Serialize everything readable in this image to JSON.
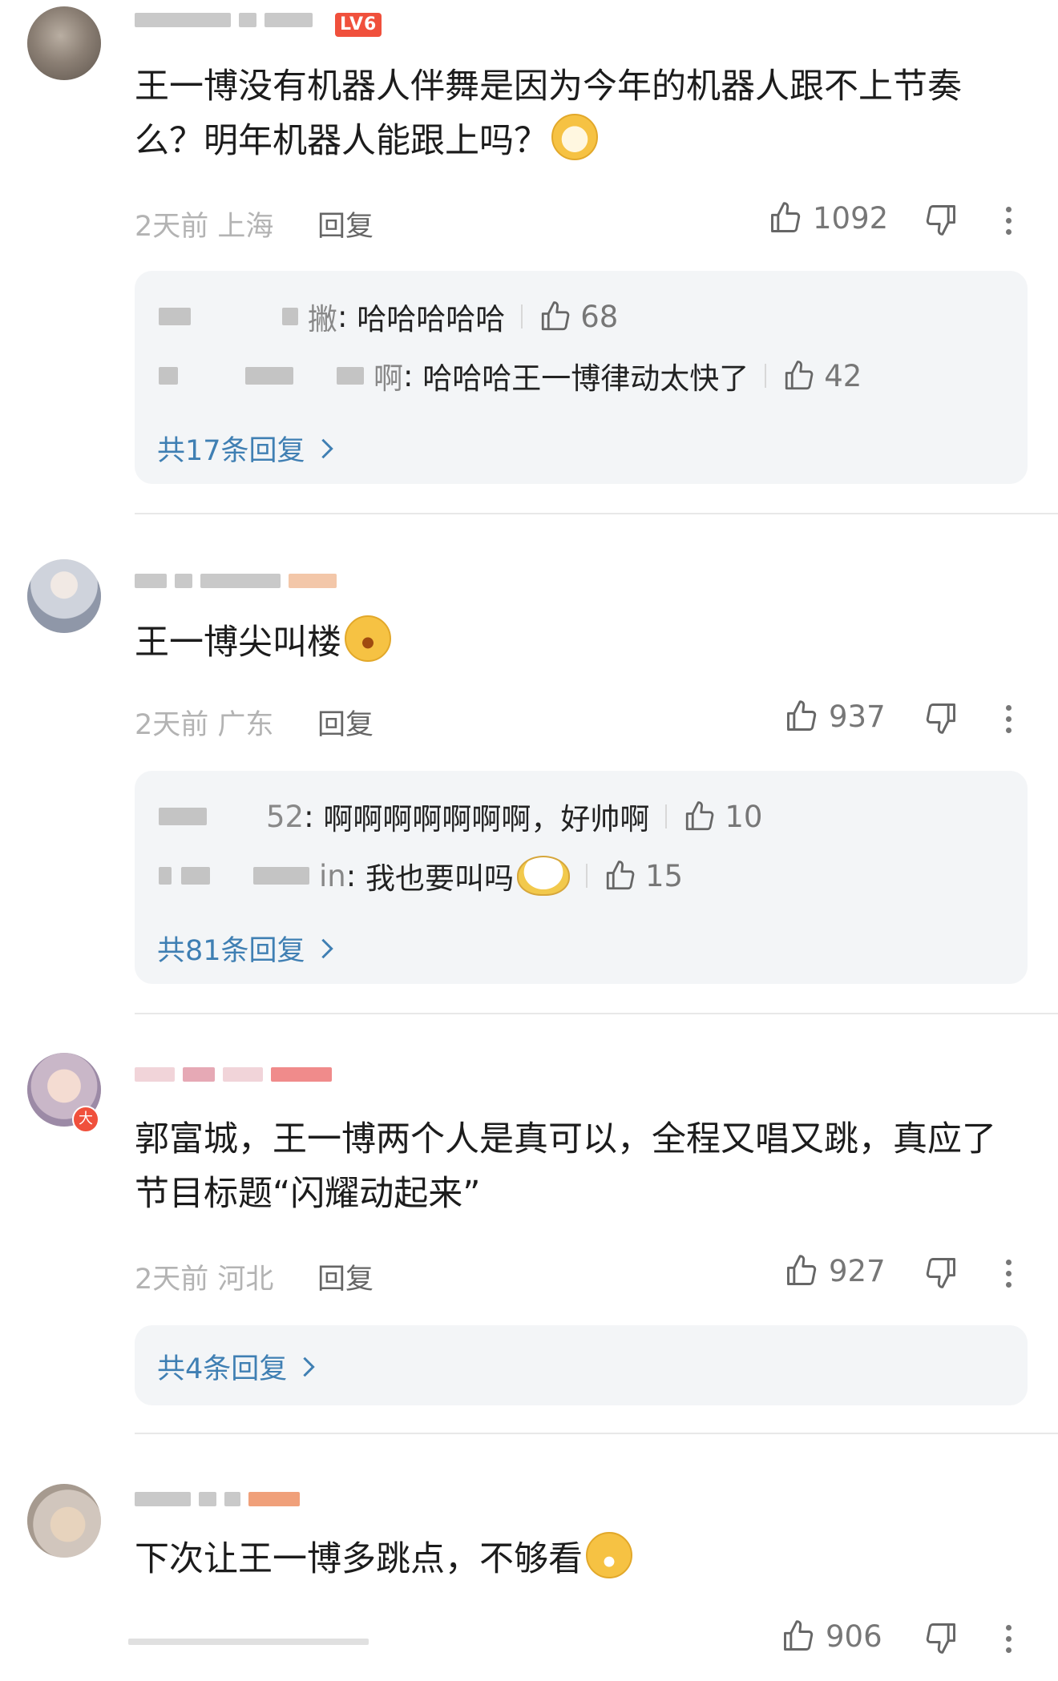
{
  "comments": [
    {
      "level": "LV6",
      "text": "王一博没有机器人伴舞是因为今年的机器人跟不上节奏么？明年机器人能跟上吗？",
      "emoji": "dog-face-emoji",
      "time": "2天前",
      "location": "上海",
      "reply_label": "回复",
      "likes": "1092",
      "replies": [
        {
          "name_suffix": "撇",
          "text": "哈哈哈哈哈",
          "likes": "68"
        },
        {
          "name_suffix": "啊",
          "text": "哈哈哈王一博律动太快了",
          "likes": "42"
        }
      ],
      "total_replies": "共17条回复"
    },
    {
      "level": "",
      "text": "王一博尖叫楼",
      "emoji": "screaming-face-emoji",
      "time": "2天前",
      "location": "广东",
      "reply_label": "回复",
      "likes": "937",
      "replies": [
        {
          "name_suffix": "52",
          "text": "啊啊啊啊啊啊啊，好帅啊",
          "likes": "10"
        },
        {
          "name_suffix": "in",
          "text": "我也要叫吗",
          "likes": "15"
        }
      ],
      "total_replies": "共81条回复"
    },
    {
      "level": "",
      "text": "郭富城，王一博两个人是真可以，全程又唱又跳，真应了节目标题“闪耀动起来”",
      "time": "2天前",
      "location": "河北",
      "reply_label": "回复",
      "likes": "927",
      "total_replies": "共4条回复",
      "avatar_badge": "大"
    },
    {
      "level": "",
      "text": "下次让王一博多跳点，不够看",
      "emoji": "crying-face-emoji",
      "likes": "906"
    }
  ],
  "colors": {
    "accent_link": "#3f7fb3",
    "level_badge": "#f0503c",
    "reply_bg": "#f3f5f7"
  }
}
